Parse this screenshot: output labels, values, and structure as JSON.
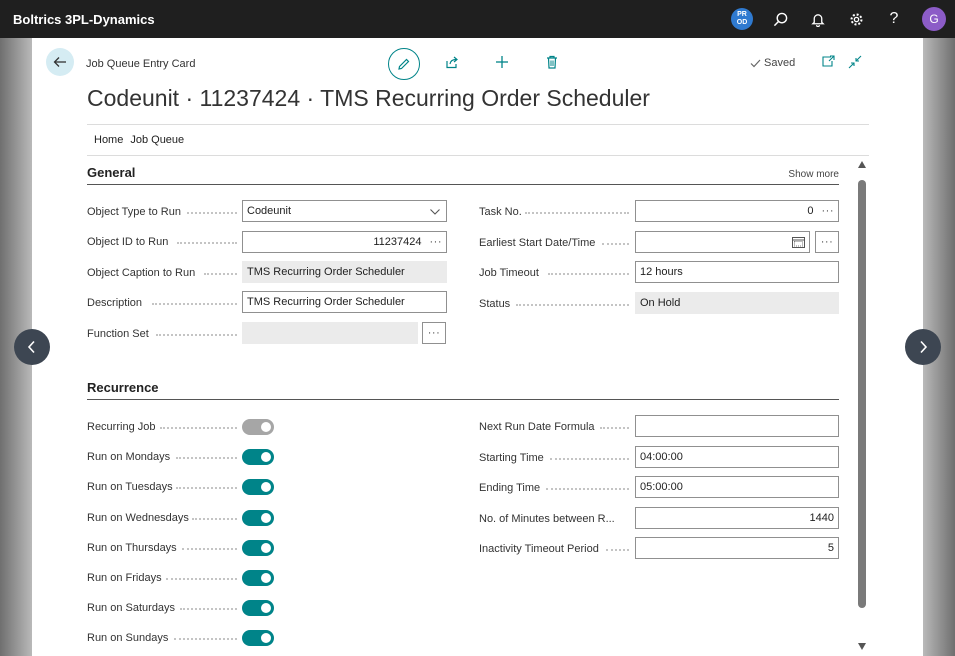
{
  "app": {
    "title": "Boltrics 3PL-Dynamics",
    "env_badge_top": "PR",
    "env_badge_bottom": "OD",
    "avatar_initial": "G"
  },
  "header": {
    "caption": "Job Queue Entry Card",
    "title": "Codeunit · 11237424 · TMS Recurring Order Scheduler",
    "saved_label": "Saved"
  },
  "tabs": [
    "Home",
    "Job Queue"
  ],
  "general": {
    "title": "General",
    "show_more": "Show more",
    "left": [
      {
        "label": "Object Type to Run",
        "value": "Codeunit"
      },
      {
        "label": "Object ID to Run",
        "value": "11237424"
      },
      {
        "label": "Object Caption to Run",
        "value": "TMS Recurring Order Scheduler"
      },
      {
        "label": "Description",
        "value": "TMS Recurring Order Scheduler"
      },
      {
        "label": "Function Set",
        "value": ""
      }
    ],
    "right": [
      {
        "label": "Task No.",
        "value": "0"
      },
      {
        "label": "Earliest Start Date/Time",
        "value": ""
      },
      {
        "label": "Job Timeout",
        "value": "12 hours"
      },
      {
        "label": "Status",
        "value": "On Hold"
      }
    ]
  },
  "recurrence": {
    "title": "Recurrence",
    "left": [
      {
        "label": "Recurring Job",
        "on": true,
        "enabled": false
      },
      {
        "label": "Run on Mondays",
        "on": true,
        "enabled": true
      },
      {
        "label": "Run on Tuesdays",
        "on": true,
        "enabled": true
      },
      {
        "label": "Run on Wednesdays",
        "on": true,
        "enabled": true
      },
      {
        "label": "Run on Thursdays",
        "on": true,
        "enabled": true
      },
      {
        "label": "Run on Fridays",
        "on": true,
        "enabled": true
      },
      {
        "label": "Run on Saturdays",
        "on": true,
        "enabled": true
      },
      {
        "label": "Run on Sundays",
        "on": true,
        "enabled": true
      }
    ],
    "right": [
      {
        "label": "Next Run Date Formula",
        "value": ""
      },
      {
        "label": "Starting Time",
        "value": "04:00:00"
      },
      {
        "label": "Ending Time",
        "value": "05:00:00"
      },
      {
        "label": "No. of Minutes between R...",
        "value": "1440"
      },
      {
        "label": "Inactivity Timeout Period",
        "value": "5"
      }
    ]
  },
  "assist_edit": "···",
  "colors": {
    "accent": "#008489",
    "appbar": "#1f1f1f"
  }
}
